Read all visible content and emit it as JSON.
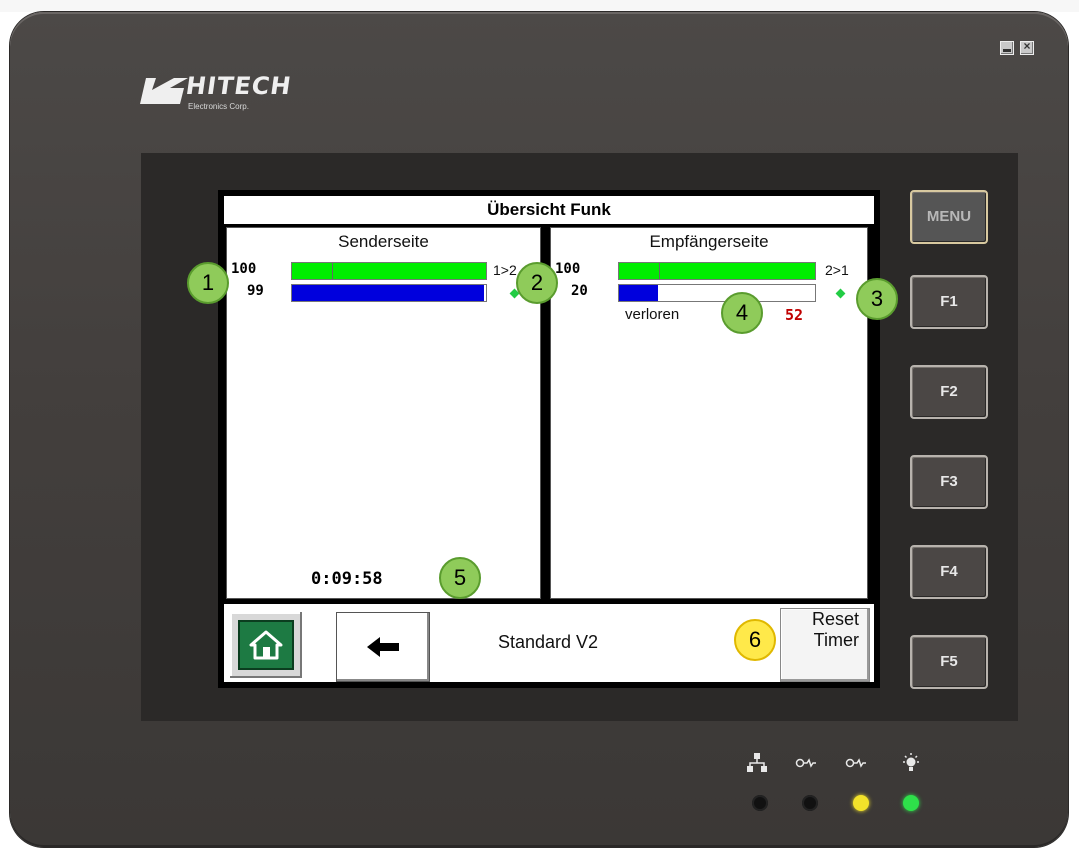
{
  "brand": {
    "name": "HITECH",
    "subtitle": "Electronics Corp."
  },
  "screen": {
    "title": "Übersicht Funk",
    "sender": {
      "heading": "Senderseite",
      "top_value": "100",
      "bottom_value": "99",
      "top_level": 1.0,
      "bottom_level": 0.99,
      "direction": "1>2",
      "timer": "0:09:58"
    },
    "receiver": {
      "heading": "Empfängerseite",
      "top_value": "100",
      "bottom_value": "20",
      "top_level": 1.0,
      "bottom_level": 0.2,
      "direction": "2>1",
      "lost_label": "verloren",
      "lost_value": "52"
    },
    "footer": {
      "mode_label": "Standard V2",
      "reset_line1": "Reset",
      "reset_line2": "Timer"
    }
  },
  "keys": {
    "menu": "MENU",
    "f1": "F1",
    "f2": "F2",
    "f3": "F3",
    "f4": "F4",
    "f5": "F5"
  },
  "callouts": [
    "1",
    "2",
    "3",
    "4",
    "5",
    "6"
  ],
  "leds": [
    {
      "icon": "network-icon",
      "state": "off"
    },
    {
      "icon": "com1-icon",
      "state": "off"
    },
    {
      "icon": "com2-icon",
      "state": "yellow"
    },
    {
      "icon": "power-icon",
      "state": "green"
    }
  ],
  "colors": {
    "housing": "#433f3d",
    "bar_green": "#00ee00",
    "bar_blue": "#0000dd",
    "lost_value": "#c00000",
    "home_button": "#1d7a43",
    "callout_green": "#8fcb5a",
    "callout_yellow": "#ffe94a"
  }
}
